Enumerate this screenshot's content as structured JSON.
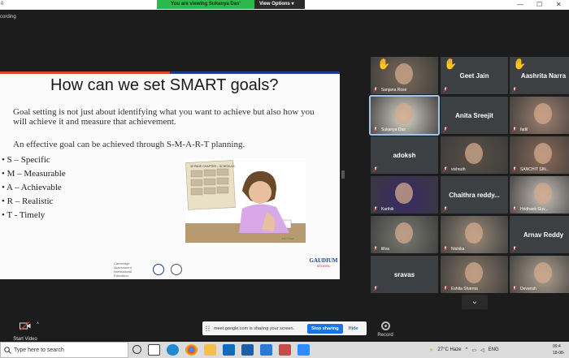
{
  "topbar": {
    "left_text": "0",
    "banner_text": "You are viewing Sukanya Das' screen",
    "view_options": "View Options ▾",
    "window_controls": [
      "—",
      "☐",
      "✕"
    ]
  },
  "recording_label": "cording",
  "slide": {
    "title": "How can we set SMART goals?",
    "para1": "Goal setting is not just about identifying what you want to achieve but also how you will achieve it and measure that achievement.",
    "para2": "An effective goal can be achieved through S-M-A-R-T planning.",
    "list": [
      "S – Specific",
      "M – Measurable",
      "A – Achievable",
      "R – Realistic",
      "T - Timely"
    ],
    "illustration_heading": "30 PAGE CHAPTER – SCHEDULE",
    "illustration_credit": "wiki How",
    "logo1": "Cambridge Assessment International Education",
    "school_name": "GAUDIUM",
    "school_sub": "SCHOOL",
    "colors": {
      "accent_red": "#e0402a",
      "accent_blue": "#1d3f8a"
    }
  },
  "participants": [
    {
      "name": "Sanjana Rose",
      "type": "video",
      "hand": true,
      "color": "#7a6a5a"
    },
    {
      "name": "Geet Jain",
      "type": "name",
      "hand": true
    },
    {
      "name": "Aashrita Narra",
      "type": "name",
      "hand": true
    },
    {
      "name": "Sukanya Das",
      "type": "video",
      "active": true,
      "color": "#d8d4c8"
    },
    {
      "name": "Anita Sreejit",
      "type": "name"
    },
    {
      "name": "fadil",
      "type": "video",
      "color": "#a08070"
    },
    {
      "name": "adoksh",
      "type": "name"
    },
    {
      "name": "vishruth",
      "type": "video",
      "color": "#5a5048"
    },
    {
      "name": "SANCHIT SIN...",
      "type": "video",
      "color": "#8a6a58"
    },
    {
      "name": "Karthik",
      "type": "video",
      "color": "#3a2a6a"
    },
    {
      "name": "Chaithra  reddy...",
      "type": "name"
    },
    {
      "name": "Hridhank Guv...",
      "type": "video",
      "color": "#c8c0b8"
    },
    {
      "name": "lillva",
      "type": "video",
      "color": "#7a7a72"
    },
    {
      "name": "Nishika",
      "type": "video",
      "color": "#9a8a7a"
    },
    {
      "name": "Arnav Reddy",
      "type": "name"
    },
    {
      "name": "sravas",
      "type": "name"
    },
    {
      "name": "Eshita Sharma",
      "type": "video",
      "color": "#8a7868"
    },
    {
      "name": "Devansh",
      "type": "video",
      "color": "#b0a090"
    }
  ],
  "more_button": "⌄",
  "controls": {
    "start_video": "Start Video",
    "record": "Record",
    "share_text": "meet.google.com is sharing your screen.",
    "stop_sharing": "Stop sharing",
    "hide": "Hide"
  },
  "taskbar": {
    "search_placeholder": "Type here to search",
    "weather": "27°C  Haze",
    "lang": "ENG",
    "time": "09:4",
    "date": "18-08-"
  }
}
